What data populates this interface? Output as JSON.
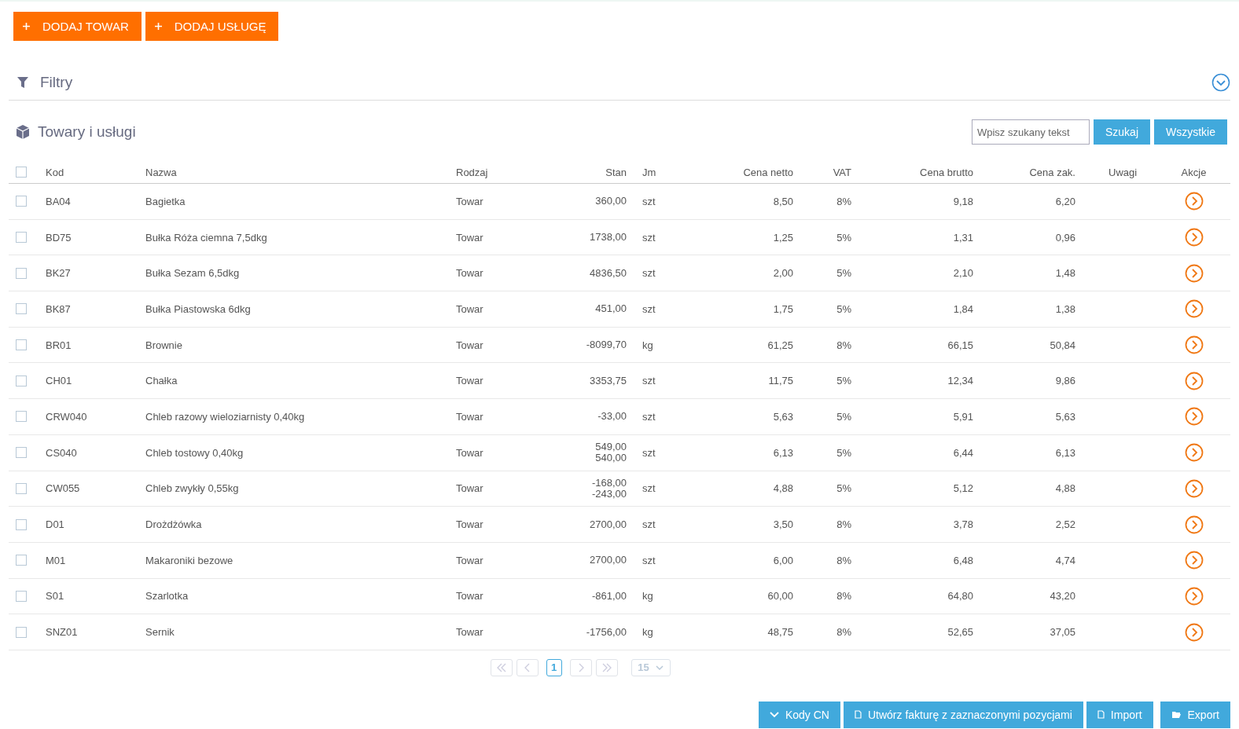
{
  "top_buttons": [
    "DODAJ TOWAR",
    "DODAJ USŁUGĘ"
  ],
  "filters": {
    "title": "Filtry",
    "expanded": false
  },
  "section": {
    "title": "Towary i usługi"
  },
  "search": {
    "placeholder": "Wpisz szukany tekst",
    "buttons": [
      "Szukaj",
      "Wszystkie"
    ]
  },
  "table": {
    "select_all": false,
    "columns": [
      "Kod",
      "Nazwa",
      "Rodzaj",
      "Stan",
      "Jm",
      "Cena netto",
      "VAT",
      "Cena brutto",
      "Cena zak.",
      "Uwagi",
      "Akcje"
    ],
    "rows": [
      {
        "checked": false,
        "kod": "BA04",
        "nazwa": "Bagietka",
        "rodzaj": "Towar",
        "stan": [
          "360,00"
        ],
        "jm": "szt",
        "netto": "8,50",
        "vat": "8%",
        "brutto": "9,18",
        "zak": "6,20"
      },
      {
        "checked": false,
        "kod": "BD75",
        "nazwa": "Bułka Róża ciemna 7,5dkg",
        "rodzaj": "Towar",
        "stan": [
          "1738,00"
        ],
        "jm": "szt",
        "netto": "1,25",
        "vat": "5%",
        "brutto": "1,31",
        "zak": "0,96"
      },
      {
        "checked": false,
        "kod": "BK27",
        "nazwa": "Bułka Sezam 6,5dkg",
        "rodzaj": "Towar",
        "stan": [
          "4836,50"
        ],
        "jm": "szt",
        "netto": "2,00",
        "vat": "5%",
        "brutto": "2,10",
        "zak": "1,48"
      },
      {
        "checked": false,
        "kod": "BK87",
        "nazwa": "Bułka Piastowska 6dkg",
        "rodzaj": "Towar",
        "stan": [
          "451,00"
        ],
        "jm": "szt",
        "netto": "1,75",
        "vat": "5%",
        "brutto": "1,84",
        "zak": "1,38"
      },
      {
        "checked": false,
        "kod": "BR01",
        "nazwa": "Brownie",
        "rodzaj": "Towar",
        "stan": [
          "-8099,70"
        ],
        "jm": "kg",
        "netto": "61,25",
        "vat": "8%",
        "brutto": "66,15",
        "zak": "50,84"
      },
      {
        "checked": false,
        "kod": "CH01",
        "nazwa": "Chałka",
        "rodzaj": "Towar",
        "stan": [
          "3353,75"
        ],
        "jm": "szt",
        "netto": "11,75",
        "vat": "5%",
        "brutto": "12,34",
        "zak": "9,86"
      },
      {
        "checked": false,
        "kod": "CRW040",
        "nazwa": "Chleb razowy wieloziarnisty 0,40kg",
        "rodzaj": "Towar",
        "stan": [
          "-33,00"
        ],
        "jm": "szt",
        "netto": "5,63",
        "vat": "5%",
        "brutto": "5,91",
        "zak": "5,63"
      },
      {
        "checked": false,
        "kod": "CS040",
        "nazwa": "Chleb tostowy 0,40kg",
        "rodzaj": "Towar",
        "stan": [
          "549,00",
          "540,00"
        ],
        "jm": "szt",
        "netto": "6,13",
        "vat": "5%",
        "brutto": "6,44",
        "zak": "6,13"
      },
      {
        "checked": false,
        "kod": "CW055",
        "nazwa": "Chleb zwykły 0,55kg",
        "rodzaj": "Towar",
        "stan": [
          "-168,00",
          "-243,00"
        ],
        "jm": "szt",
        "netto": "4,88",
        "vat": "5%",
        "brutto": "5,12",
        "zak": "4,88"
      },
      {
        "checked": false,
        "kod": "D01",
        "nazwa": "Drożdżówka",
        "rodzaj": "Towar",
        "stan": [
          "2700,00"
        ],
        "jm": "szt",
        "netto": "3,50",
        "vat": "8%",
        "brutto": "3,78",
        "zak": "2,52"
      },
      {
        "checked": false,
        "kod": "M01",
        "nazwa": "Makaroniki bezowe",
        "rodzaj": "Towar",
        "stan": [
          "2700,00"
        ],
        "jm": "szt",
        "netto": "6,00",
        "vat": "8%",
        "brutto": "6,48",
        "zak": "4,74"
      },
      {
        "checked": false,
        "kod": "S01",
        "nazwa": "Szarlotka",
        "rodzaj": "Towar",
        "stan": [
          "-861,00"
        ],
        "jm": "kg",
        "netto": "60,00",
        "vat": "8%",
        "brutto": "64,80",
        "zak": "43,20"
      },
      {
        "checked": false,
        "kod": "SNZ01",
        "nazwa": "Sernik",
        "rodzaj": "Towar",
        "stan": [
          "-1756,00"
        ],
        "jm": "kg",
        "netto": "48,75",
        "vat": "8%",
        "brutto": "52,65",
        "zak": "37,05"
      }
    ]
  },
  "pagination": {
    "pages": [
      {
        "label": "1",
        "selected": true
      }
    ],
    "page_size": "15"
  },
  "bottom_buttons": [
    {
      "kind": "dropdown",
      "label": "Kody CN"
    },
    {
      "kind": "document",
      "label": "Utwórz fakturę z zaznaczonymi pozycjami"
    },
    {
      "kind": "document",
      "label": "Import"
    },
    {
      "kind": "folder",
      "label": "Export"
    }
  ]
}
